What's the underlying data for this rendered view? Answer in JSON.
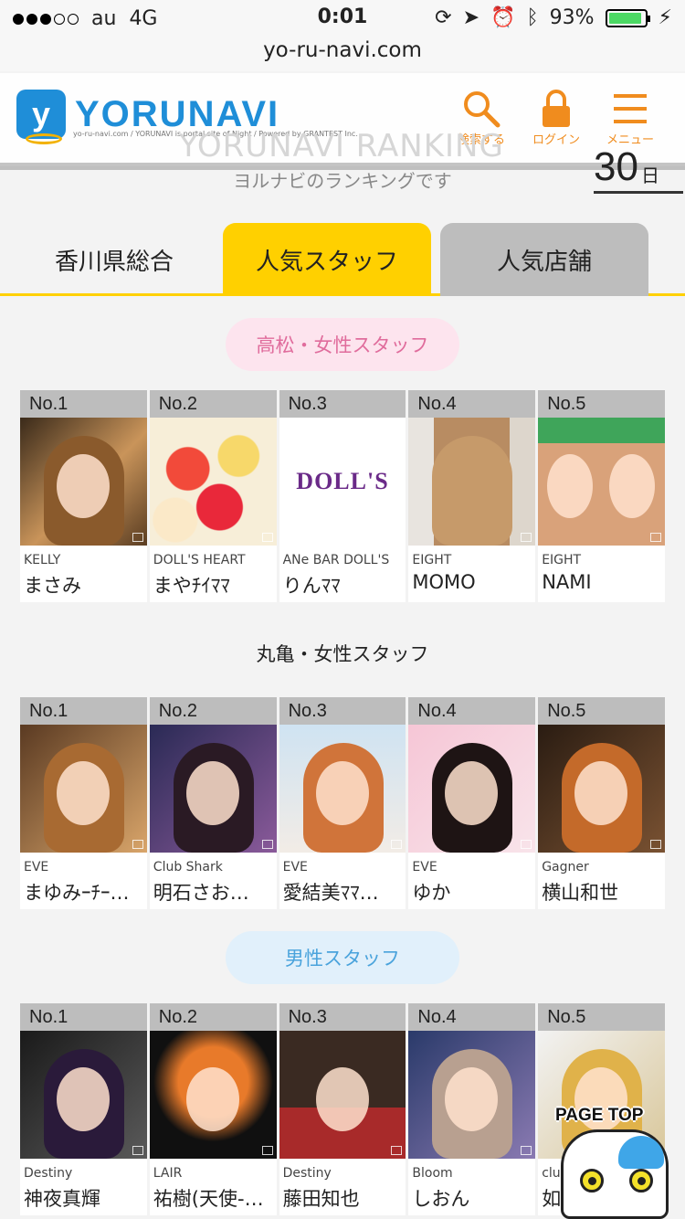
{
  "statusbar": {
    "carrier": "au",
    "network": "4G",
    "time": "0:01",
    "battery": "93%",
    "battery_level": 0.93
  },
  "url": "yo-ru-navi.com",
  "header": {
    "logo_text": "YORUNAVI",
    "logo_sub": "yo-ru-navi.com / YORUNAVI is portal site of Night / Powered by GRANTEST Inc.",
    "search_label": "検索する",
    "login_label": "ログイン",
    "menu_label": "メニュー",
    "ranking_title": "YORUNAVI RANKING",
    "subtitle": "ヨルナビのランキングです",
    "day_number": "30",
    "day_unit": "日"
  },
  "tabs": [
    {
      "label": "香川県総合"
    },
    {
      "label": "人気スタッフ"
    },
    {
      "label": "人気店舗"
    }
  ],
  "sections": [
    {
      "title": "高松・女性スタッフ",
      "cards": [
        {
          "rank": "No.1",
          "shop": "KELLY",
          "name": "まさみ"
        },
        {
          "rank": "No.2",
          "shop": "DOLL'S HEART",
          "name": "まやﾁｲﾏﾏ"
        },
        {
          "rank": "No.3",
          "shop": "ANe BAR DOLL'S",
          "name": "りんﾏﾏ",
          "logo": "DOLL'S"
        },
        {
          "rank": "No.4",
          "shop": "EIGHT",
          "name": "MOMO"
        },
        {
          "rank": "No.5",
          "shop": "EIGHT",
          "name": "NAMI"
        }
      ]
    },
    {
      "title": "丸亀・女性スタッフ",
      "cards": [
        {
          "rank": "No.1",
          "shop": "EVE",
          "name": "まゆみｰﾁｰ…"
        },
        {
          "rank": "No.2",
          "shop": "Club Shark",
          "name": "明石さお…"
        },
        {
          "rank": "No.3",
          "shop": "EVE",
          "name": "愛結美ﾏﾏ…"
        },
        {
          "rank": "No.4",
          "shop": "EVE",
          "name": "ゆか"
        },
        {
          "rank": "No.5",
          "shop": "Gagner",
          "name": "横山和世"
        }
      ]
    },
    {
      "title": "男性スタッフ",
      "cards": [
        {
          "rank": "No.1",
          "shop": "Destiny",
          "name": "神夜真輝"
        },
        {
          "rank": "No.2",
          "shop": "LAIR",
          "name": "祐樹(天使-…"
        },
        {
          "rank": "No.3",
          "shop": "Destiny",
          "name": "藤田知也"
        },
        {
          "rank": "No.4",
          "shop": "Bloom",
          "name": "しおん"
        },
        {
          "rank": "No.5",
          "shop": "club",
          "name": "如"
        }
      ]
    }
  ],
  "page_top_label": "PAGE TOP",
  "colors": {
    "accent_yellow": "#ffd000",
    "brand_blue": "#1f8ed8",
    "header_orange": "#f08c1e",
    "pink_pill": "#fde4ee",
    "blue_pill": "#e1f0fb"
  }
}
